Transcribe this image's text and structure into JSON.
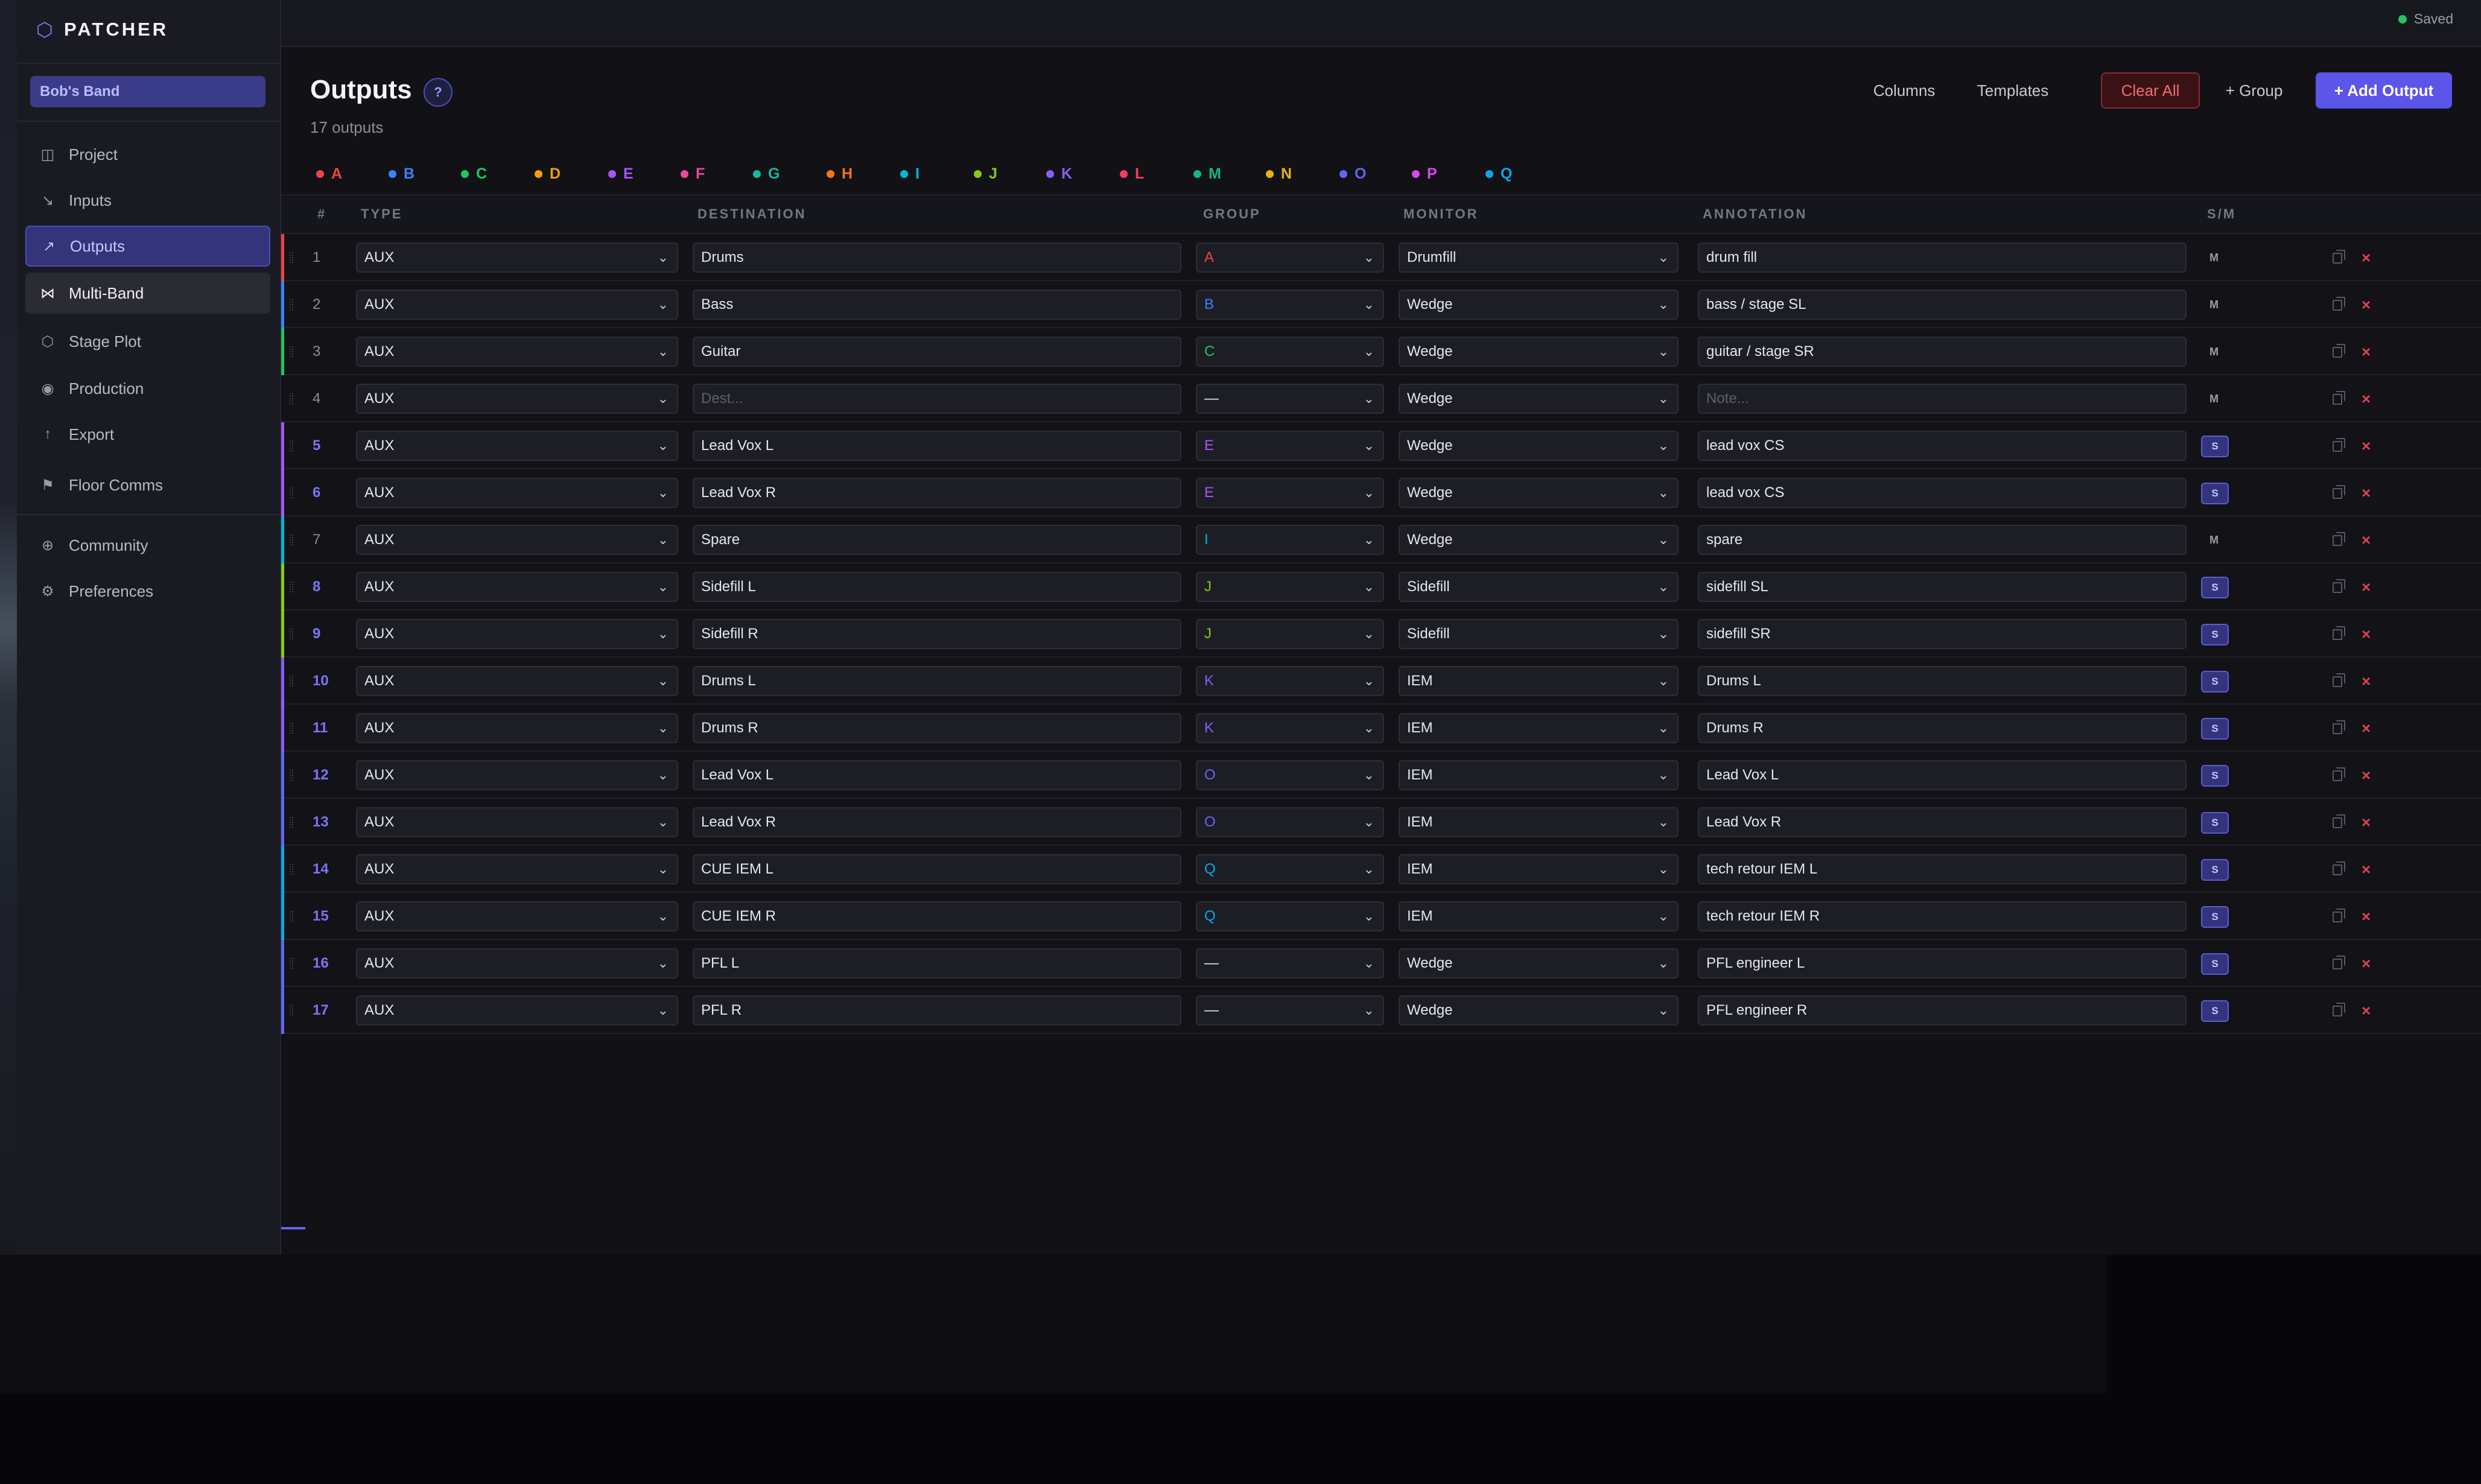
{
  "app": {
    "name": "PATCHER",
    "brand_icon": "hexagon-icon",
    "project": "Bob's Band"
  },
  "sidebar": {
    "items": [
      {
        "label": "Project",
        "icon": "layout-icon",
        "glyph": "◫"
      },
      {
        "label": "Inputs",
        "icon": "arrow-down-right-icon",
        "glyph": "↘"
      },
      {
        "label": "Outputs",
        "icon": "arrow-up-right-icon",
        "glyph": "↗"
      },
      {
        "label": "Multi-Band",
        "icon": "bowtie-icon",
        "glyph": "⋈"
      },
      {
        "label": "Stage Plot",
        "icon": "hexagon-icon",
        "glyph": "⬡"
      },
      {
        "label": "Production",
        "icon": "target-icon",
        "glyph": "◉"
      },
      {
        "label": "Export",
        "icon": "arrow-up-icon",
        "glyph": "↑"
      },
      {
        "label": "Floor Comms",
        "icon": "flag-icon",
        "glyph": "⚑"
      },
      {
        "label": "Community",
        "icon": "globe-icon",
        "glyph": "⊕"
      },
      {
        "label": "Preferences",
        "icon": "gear-icon",
        "glyph": "⚙"
      }
    ]
  },
  "header": {
    "status": "Saved",
    "status_color": "#22c55e"
  },
  "page": {
    "title": "Outputs",
    "help": "?",
    "count": "17 outputs",
    "buttons": {
      "columns": "Columns",
      "templates": "Templates",
      "clear": "Clear All",
      "group": "+ Group",
      "add": "+ Add Output"
    }
  },
  "legend": [
    {
      "letter": "A",
      "color": "#ef4444"
    },
    {
      "letter": "B",
      "color": "#3b82f6"
    },
    {
      "letter": "C",
      "color": "#22c55e"
    },
    {
      "letter": "D",
      "color": "#f59e0b"
    },
    {
      "letter": "E",
      "color": "#a855f7"
    },
    {
      "letter": "F",
      "color": "#ec4899"
    },
    {
      "letter": "G",
      "color": "#14b8a6"
    },
    {
      "letter": "H",
      "color": "#f97316"
    },
    {
      "letter": "I",
      "color": "#06b6d4"
    },
    {
      "letter": "J",
      "color": "#84cc16"
    },
    {
      "letter": "K",
      "color": "#8b5cf6"
    },
    {
      "letter": "L",
      "color": "#f43f5e"
    },
    {
      "letter": "M",
      "color": "#10b981"
    },
    {
      "letter": "N",
      "color": "#eab308"
    },
    {
      "letter": "O",
      "color": "#6366f1"
    },
    {
      "letter": "P",
      "color": "#d946ef"
    },
    {
      "letter": "Q",
      "color": "#0ea5e9"
    }
  ],
  "table": {
    "headers": [
      "#",
      "TYPE",
      "DESTINATION",
      "GROUP",
      "MONITOR",
      "ANNOTATION",
      "S/M"
    ],
    "rows": [
      {
        "num": "1",
        "type": "AUX",
        "destination": "Drums",
        "group": "A",
        "monitor": "Drumfill",
        "annotation": "drum fill",
        "sm": "M"
      },
      {
        "num": "2",
        "type": "AUX",
        "destination": "Bass",
        "group": "B",
        "monitor": "Wedge",
        "annotation": "bass / stage SL",
        "sm": "M"
      },
      {
        "num": "3",
        "type": "AUX",
        "destination": "Guitar",
        "group": "C",
        "monitor": "Wedge",
        "annotation": "guitar / stage SR",
        "sm": "M"
      },
      {
        "num": "4",
        "type": "AUX",
        "destination": "",
        "dest_placeholder": "Dest...",
        "group": "—",
        "monitor": "Wedge",
        "annotation": "",
        "note_placeholder": "Note...",
        "sm": "M"
      },
      {
        "num": "5",
        "type": "AUX",
        "destination": "Lead Vox L",
        "group": "E",
        "monitor": "Wedge",
        "annotation": "lead vox CS",
        "sm": "S"
      },
      {
        "num": "6",
        "type": "AUX",
        "destination": "Lead Vox R",
        "group": "E",
        "monitor": "Wedge",
        "annotation": "lead vox CS",
        "sm": "S"
      },
      {
        "num": "7",
        "type": "AUX",
        "destination": "Spare",
        "group": "I",
        "monitor": "Wedge",
        "annotation": "spare",
        "sm": "M"
      },
      {
        "num": "8",
        "type": "AUX",
        "destination": "Sidefill L",
        "group": "J",
        "monitor": "Sidefill",
        "annotation": "sidefill SL",
        "sm": "S"
      },
      {
        "num": "9",
        "type": "AUX",
        "destination": "Sidefill R",
        "group": "J",
        "monitor": "Sidefill",
        "annotation": "sidefill SR",
        "sm": "S"
      },
      {
        "num": "10",
        "type": "AUX",
        "destination": "Drums L",
        "group": "K",
        "monitor": "IEM",
        "annotation": "Drums L",
        "sm": "S"
      },
      {
        "num": "11",
        "type": "AUX",
        "destination": "Drums R",
        "group": "K",
        "monitor": "IEM",
        "annotation": "Drums R",
        "sm": "S"
      },
      {
        "num": "12",
        "type": "AUX",
        "destination": "Lead Vox L",
        "group": "O",
        "monitor": "IEM",
        "annotation": "Lead Vox L",
        "sm": "S"
      },
      {
        "num": "13",
        "type": "AUX",
        "destination": "Lead Vox R",
        "group": "O",
        "monitor": "IEM",
        "annotation": "Lead Vox R",
        "sm": "S"
      },
      {
        "num": "14",
        "type": "AUX",
        "destination": "CUE IEM L",
        "group": "Q",
        "monitor": "IEM",
        "annotation": "tech retour IEM L",
        "sm": "S"
      },
      {
        "num": "15",
        "type": "AUX",
        "destination": "CUE IEM R",
        "group": "Q",
        "monitor": "IEM",
        "annotation": "tech retour IEM R",
        "sm": "S"
      },
      {
        "num": "16",
        "type": "AUX",
        "destination": "PFL L",
        "group": "—",
        "monitor": "Wedge",
        "annotation": "PFL engineer L",
        "sm": "S"
      },
      {
        "num": "17",
        "type": "AUX",
        "destination": "PFL R",
        "group": "—",
        "monitor": "Wedge",
        "annotation": "PFL engineer R",
        "sm": "S"
      }
    ]
  }
}
